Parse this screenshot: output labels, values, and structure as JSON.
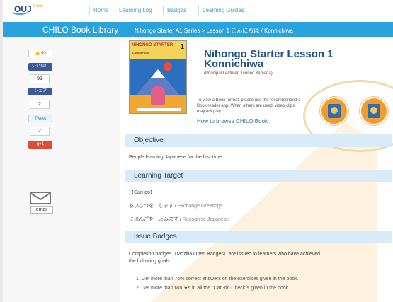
{
  "nav": {
    "logo": "OUJ",
    "logo_sub": "mooc",
    "links": [
      "Home",
      "Learning Log",
      "Badges",
      "Learning Guides"
    ]
  },
  "header": {
    "site_title": "CHILO Book Library",
    "breadcrumb": "Nihongo Starter A1 Series > Lesson 1 こんにちは / Konnichiwa"
  },
  "share": {
    "like_label": "いいね！",
    "like_count": "93",
    "facebook_like": "いいね！",
    "count_1": "93",
    "facebook_share": "シェア",
    "count_2": "2",
    "tweet": "Tweet",
    "count_3": "2",
    "gplus": "g+1",
    "email_label": "email"
  },
  "book": {
    "cover_title": "NIHONGO STARTER",
    "cover_number": "1",
    "cover_subtitle": "Konnichiwa",
    "title": "Nihongo Starter Lesson 1 Konnichiwa",
    "lecturer": "(Principal Lecturer: Tsuneo Yamada)",
    "reader_note": "To view a Book format, please use the recommended e-Book reader app. When others are used, video clips may not play.",
    "howto_link": "How to browse CHILO Book"
  },
  "sections": {
    "objective_heading": "Objective",
    "objective_text": "People learning Japanese for the first time",
    "target_heading": "Learning Target",
    "cando_label": "【Can-do】",
    "cando_1_jp": "あいさつを　します /",
    "cando_1_en": " Exchange Greetings",
    "cando_2_jp": "にほんごを　よみます /",
    "cando_2_en": " Recognise Japanese",
    "badges_heading": "Issue Badges",
    "badges_text_1": "Completion badges（Mozilla Open Badges）are issued to learners who have achieved",
    "badges_text_2": "the following goals:",
    "goals": [
      "1.  Get more than 75% correct answers on the exercises given in the book.",
      "2.  Get more than two ★s in all the \"Can-do Check\"s given in the book."
    ]
  },
  "colors": {
    "title_bar": "#2aa3dd",
    "section_bar": "#d9ebf7",
    "accent_orange": "#f39c29",
    "title_text": "#1f4f86"
  }
}
